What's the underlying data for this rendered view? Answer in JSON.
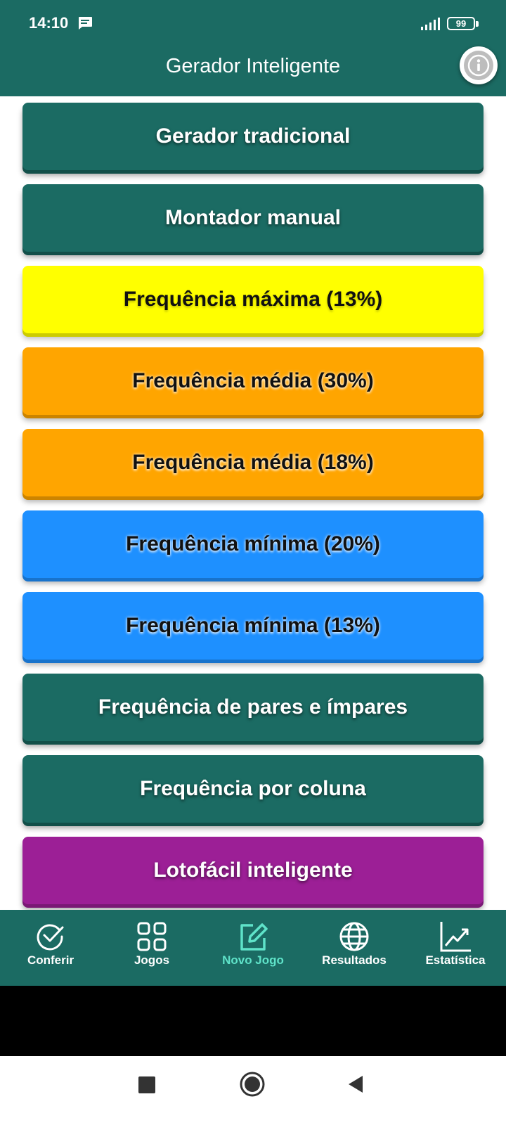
{
  "status_bar": {
    "time": "14:10",
    "battery": "99"
  },
  "header": {
    "title": "Gerador Inteligente",
    "info_icon": "info-icon"
  },
  "options": [
    {
      "label": "Gerador tradicional",
      "color": "#1b6b63"
    },
    {
      "label": "Montador manual",
      "color": "#1b6b63"
    },
    {
      "label": "Frequência máxima (13%)",
      "color": "#ffff00"
    },
    {
      "label": "Frequência média (30%)",
      "color": "#ffa500"
    },
    {
      "label": "Frequência média (18%)",
      "color": "#ffa500"
    },
    {
      "label": "Frequência mínima (20%)",
      "color": "#1e90ff"
    },
    {
      "label": "Frequência mínima (13%)",
      "color": "#1e90ff"
    },
    {
      "label": "Frequência de pares e ímpares",
      "color": "#1b6b63"
    },
    {
      "label": "Frequência por coluna",
      "color": "#1b6b63"
    },
    {
      "label": "Lotofácil inteligente",
      "color": "#9c1f96"
    }
  ],
  "bottom_nav": [
    {
      "label": "Conferir",
      "icon": "check-circle-icon"
    },
    {
      "label": "Jogos",
      "icon": "grid-icon"
    },
    {
      "label": "Novo Jogo",
      "icon": "edit-icon",
      "active": true
    },
    {
      "label": "Resultados",
      "icon": "globe-icon"
    },
    {
      "label": "Estatística",
      "icon": "trending-up-icon"
    }
  ],
  "colors": {
    "primary": "#1b6b63",
    "active_nav": "#5fe3c9"
  }
}
